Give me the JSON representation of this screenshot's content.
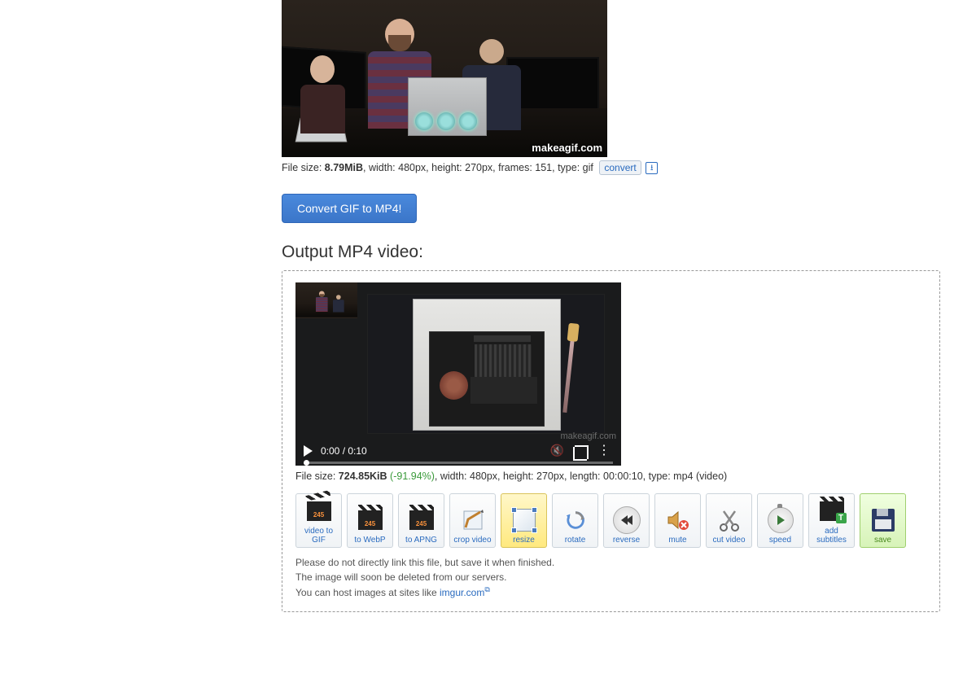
{
  "input": {
    "watermark": "makeagif.com",
    "file_info": {
      "size_label": "File size: ",
      "size_value": "8.79MiB",
      "rest": ", width: 480px, height: 270px, frames: 151, type: gif",
      "convert_label": "convert"
    }
  },
  "convert_button": "Convert GIF to MP4!",
  "output_heading": "Output MP4 video:",
  "output": {
    "player": {
      "time": "0:00 / 0:10",
      "watermark": "makeagif.com"
    },
    "file_info": {
      "size_label": "File size: ",
      "size_value": "724.85KiB",
      "pct": " (-91.94%)",
      "rest": ", width: 480px, height: 270px, length: 00:00:10, type: mp4 (video)"
    },
    "tools": [
      {
        "key": "video-to-gif",
        "label": "video to GIF"
      },
      {
        "key": "to-webp",
        "label": "to WebP"
      },
      {
        "key": "to-apng",
        "label": "to APNG"
      },
      {
        "key": "crop-video",
        "label": "crop video"
      },
      {
        "key": "resize",
        "label": "resize",
        "selected": true
      },
      {
        "key": "rotate",
        "label": "rotate"
      },
      {
        "key": "reverse",
        "label": "reverse"
      },
      {
        "key": "mute",
        "label": "mute"
      },
      {
        "key": "cut-video",
        "label": "cut video"
      },
      {
        "key": "speed",
        "label": "speed"
      },
      {
        "key": "add-subtitles",
        "label": "add subtitles"
      },
      {
        "key": "save",
        "label": "save",
        "save": true
      }
    ],
    "notes": {
      "line1": "Please do not directly link this file, but save it when finished.",
      "line2": "The image will soon be deleted from our servers.",
      "line3a": "You can host images at sites like ",
      "host_link": "imgur.com"
    }
  }
}
